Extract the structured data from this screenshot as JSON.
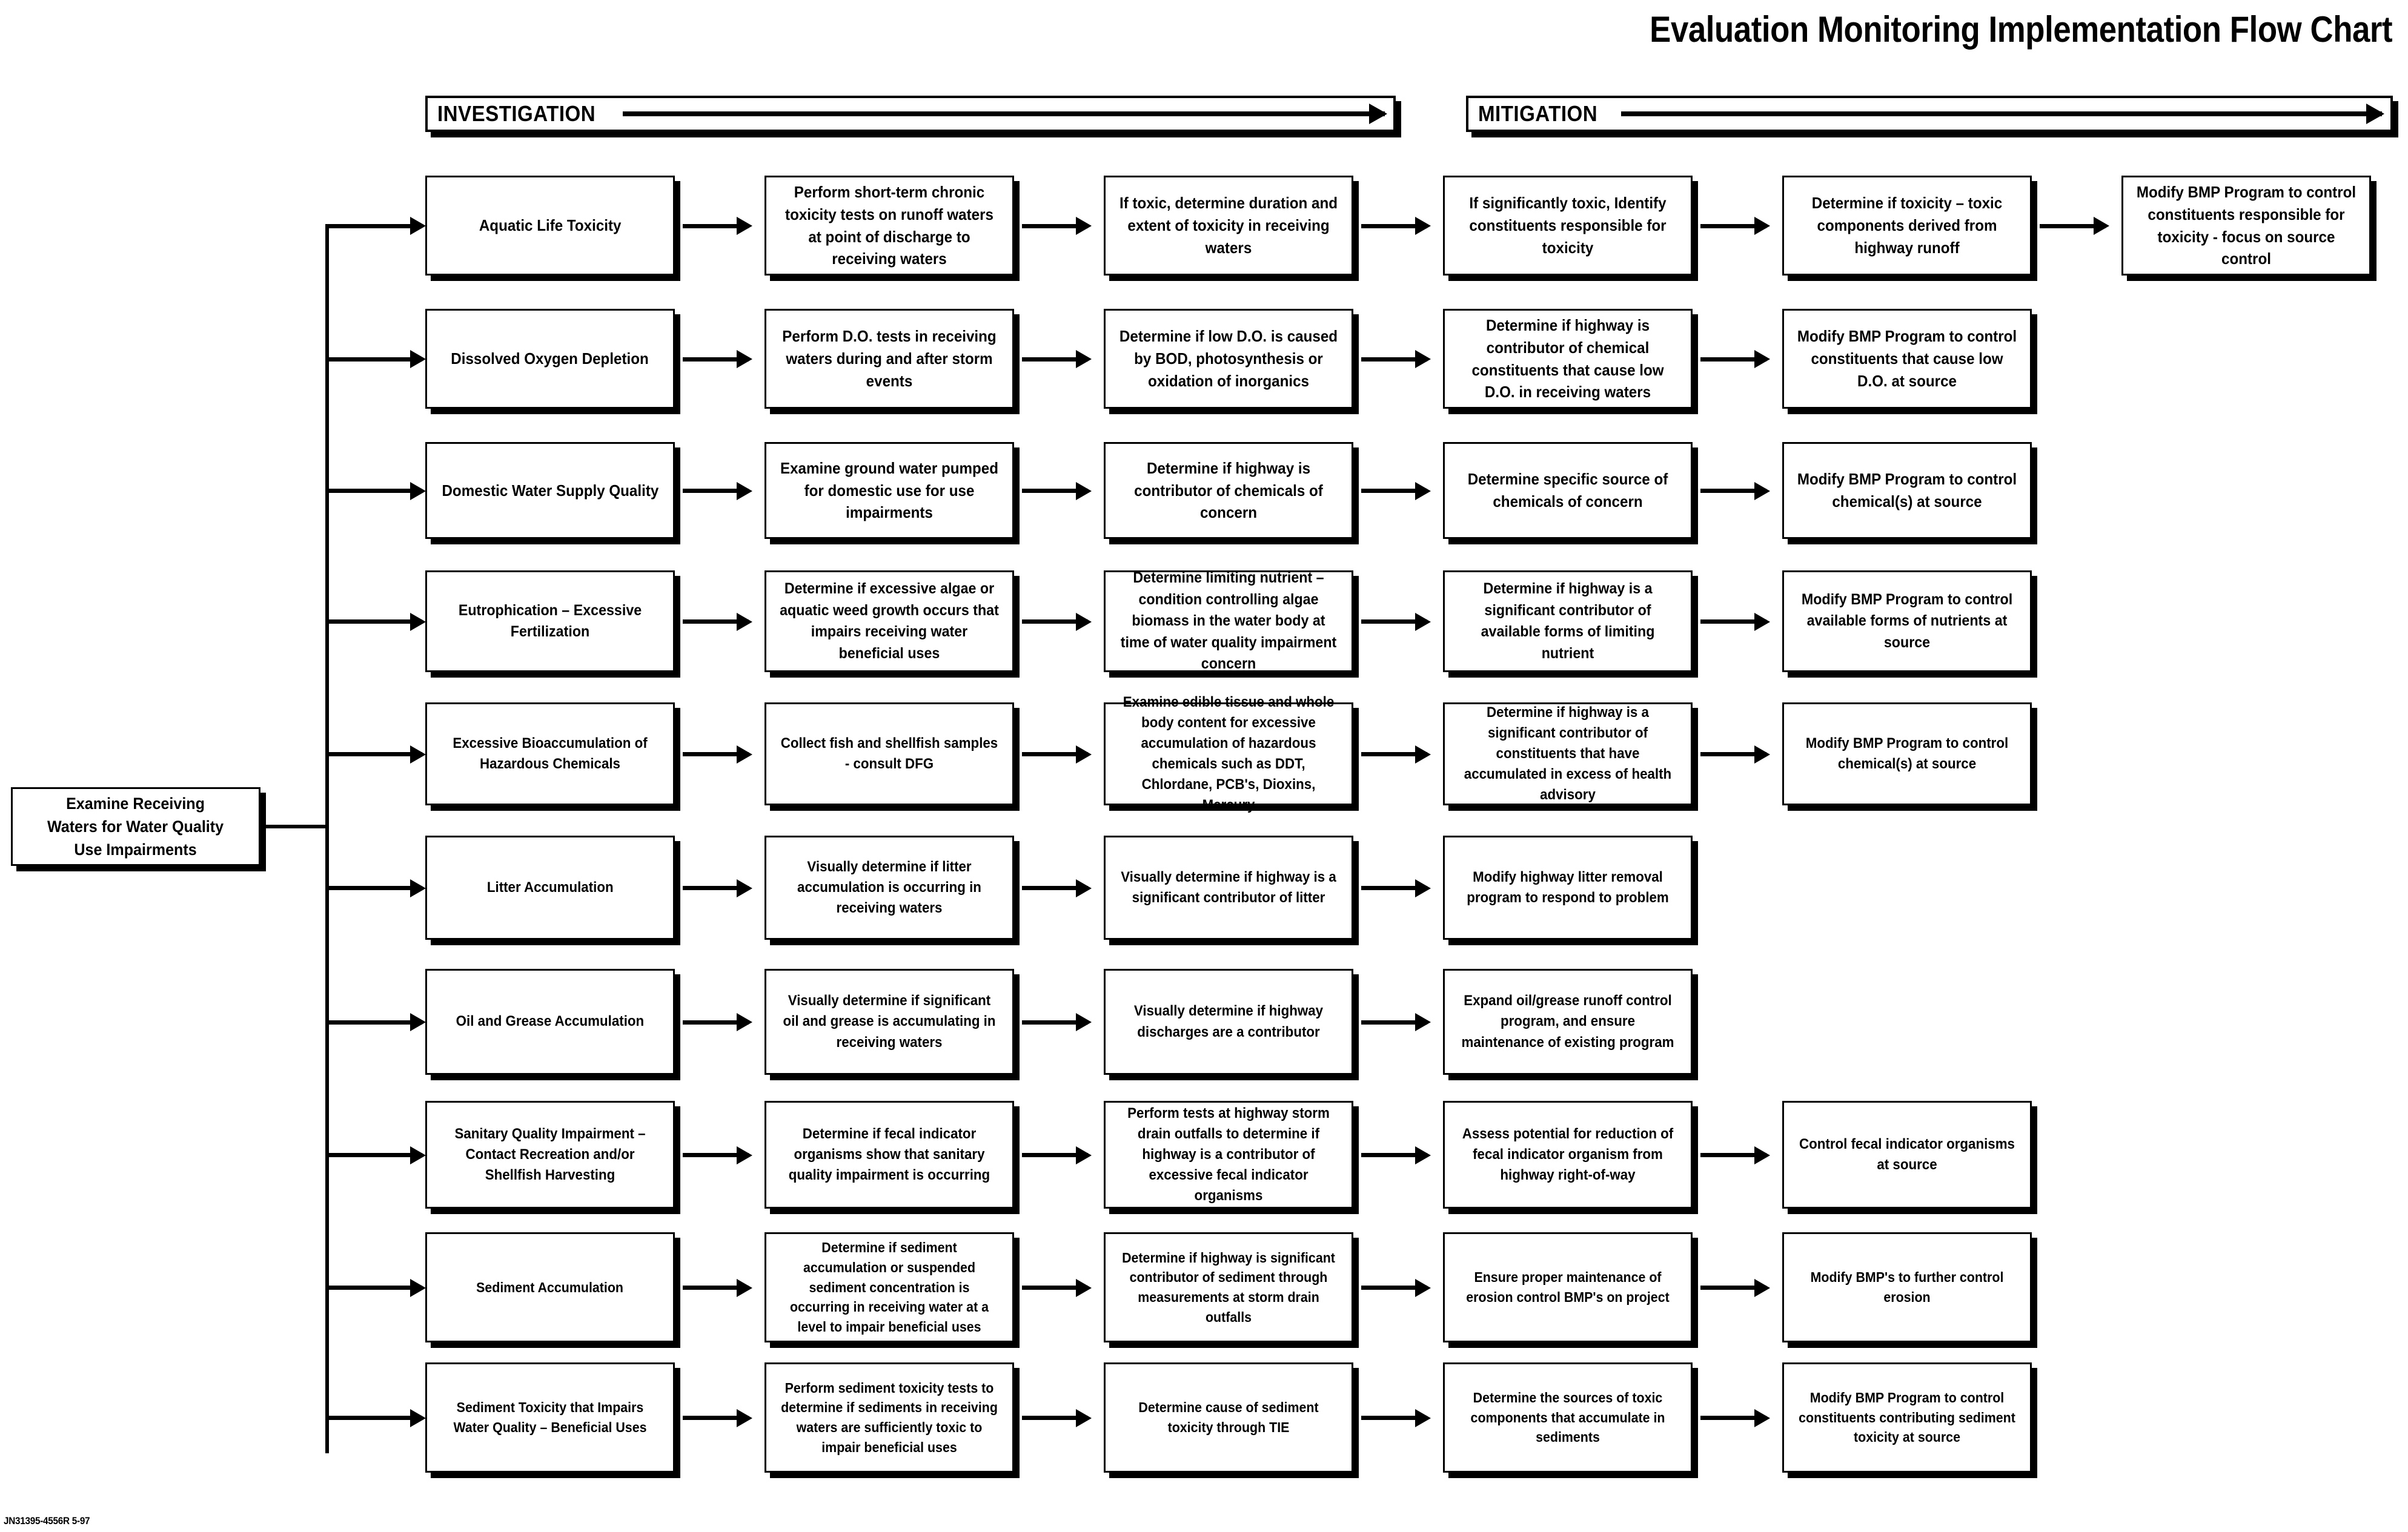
{
  "title": "Evaluation Monitoring Implementation Flow Chart",
  "footer_code": "JN31395-4556R 5-97",
  "colors": {
    "ink": "#000000",
    "paper": "#ffffff",
    "shadow": "#000000"
  },
  "phases": [
    {
      "id": "investigation",
      "label": "INVESTIGATION",
      "arrow_icon": "right-arrow-icon"
    },
    {
      "id": "mitigation",
      "label": "MITIGATION",
      "arrow_icon": "right-arrow-icon"
    }
  ],
  "root": {
    "label": "Examine Receiving Waters for Water Quality Use Impairments",
    "lines": [
      "Examine Receiving",
      "Waters for Water Quality",
      "Use Impairments"
    ]
  },
  "columns": [
    {
      "index": 0,
      "name": "impairment-category"
    },
    {
      "index": 1,
      "name": "investigation-step-1"
    },
    {
      "index": 2,
      "name": "investigation-step-2"
    },
    {
      "index": 3,
      "name": "mitigation-step-1"
    },
    {
      "index": 4,
      "name": "mitigation-step-2"
    },
    {
      "index": 5,
      "name": "mitigation-step-3"
    }
  ],
  "rows": [
    {
      "id": "aquatic-life-toxicity",
      "cells": [
        "Aquatic Life Toxicity",
        "Perform short-term chronic toxicity tests on runoff waters at point of discharge to receiving waters",
        "If toxic, determine duration and extent of toxicity in receiving waters",
        "If significantly toxic, Identify constituents responsible for toxicity",
        "Determine if toxicity – toxic components derived from highway runoff",
        "Modify BMP Program to control constituents responsible for toxicity - focus on source control"
      ]
    },
    {
      "id": "dissolved-oxygen-depletion",
      "cells": [
        "Dissolved Oxygen Depletion",
        "Perform D.O. tests in receiving waters during and after storm events",
        "Determine if low D.O. is caused by BOD, photosynthesis or oxidation of inorganics",
        "Determine if highway is contributor of chemical constituents that cause low D.O. in receiving waters",
        "Modify BMP Program to control constituents that cause low D.O. at source",
        ""
      ]
    },
    {
      "id": "domestic-water-supply-quality",
      "cells": [
        "Domestic Water Supply Quality",
        "Examine ground water pumped for domestic use for use impairments",
        "Determine if highway is contributor of chemicals of concern",
        "Determine specific source of chemicals of concern",
        "Modify BMP Program to control chemical(s) at source",
        ""
      ]
    },
    {
      "id": "eutrophication-excessive-fertilization",
      "cells": [
        "Eutrophication – Excessive Fertilization",
        "Determine if excessive algae or aquatic weed growth occurs that impairs receiving water beneficial uses",
        "Determine limiting nutrient – condition controlling algae biomass in the water body at time of water quality impairment concern",
        "Determine if highway is a significant contributor of available forms of limiting nutrient",
        "Modify BMP Program to control available forms of nutrients at source",
        ""
      ]
    },
    {
      "id": "excessive-bioaccumulation-of-hazardous-chemicals",
      "cells": [
        "Excessive Bioaccumulation of Hazardous Chemicals",
        "Collect fish and shellfish samples - consult DFG",
        "Examine edible tissue and whole body content for excessive accumulation of hazardous chemicals such as DDT, Chlordane, PCB's, Dioxins, Mercury",
        "Determine if highway is a significant contributor of constituents that have accumulated in excess of health advisory",
        "Modify BMP Program to control chemical(s) at source",
        ""
      ]
    },
    {
      "id": "litter-accumulation",
      "cells": [
        "Litter Accumulation",
        "Visually determine if litter accumulation is occurring in receiving waters",
        "Visually determine if highway is a significant contributor of litter",
        "Modify highway litter removal program to respond to problem",
        "",
        ""
      ]
    },
    {
      "id": "oil-and-grease-accumulation",
      "cells": [
        "Oil and Grease Accumulation",
        "Visually determine if significant oil and grease is accumulating in receiving waters",
        "Visually determine if highway discharges are a contributor",
        "Expand oil/grease runoff control program, and ensure maintenance of existing program",
        "",
        ""
      ]
    },
    {
      "id": "sanitary-quality-impairment",
      "cells": [
        "Sanitary Quality Impairment – Contact Recreation and/or Shellfish Harvesting",
        "Determine if fecal indicator organisms show that sanitary quality impairment is occurring",
        "Perform tests at highway storm drain outfalls to determine if highway is a contributor of excessive fecal indicator organisms",
        "Assess potential for reduction of fecal indicator organism from highway right-of-way",
        "Control fecal indicator organisms at source",
        ""
      ]
    },
    {
      "id": "sediment-accumulation",
      "cells": [
        "Sediment Accumulation",
        "Determine if sediment accumulation or suspended sediment concentration is occurring in receiving water at a level to impair beneficial uses",
        "Determine if highway is significant contributor of sediment through measurements at storm drain outfalls",
        "Ensure proper maintenance of erosion control BMP's on project",
        "Modify BMP's to further control erosion",
        ""
      ]
    },
    {
      "id": "sediment-toxicity-impairs-water-quality",
      "cells": [
        "Sediment Toxicity that Impairs Water Quality – Beneficial Uses",
        "Perform sediment toxicity tests to determine if sediments in receiving waters are sufficiently toxic to impair beneficial uses",
        "Determine cause of sediment toxicity through TIE",
        "Determine the sources of toxic components that accumulate in sediments",
        "Modify BMP Program to control constituents contributing sediment toxicity at source",
        ""
      ]
    }
  ]
}
